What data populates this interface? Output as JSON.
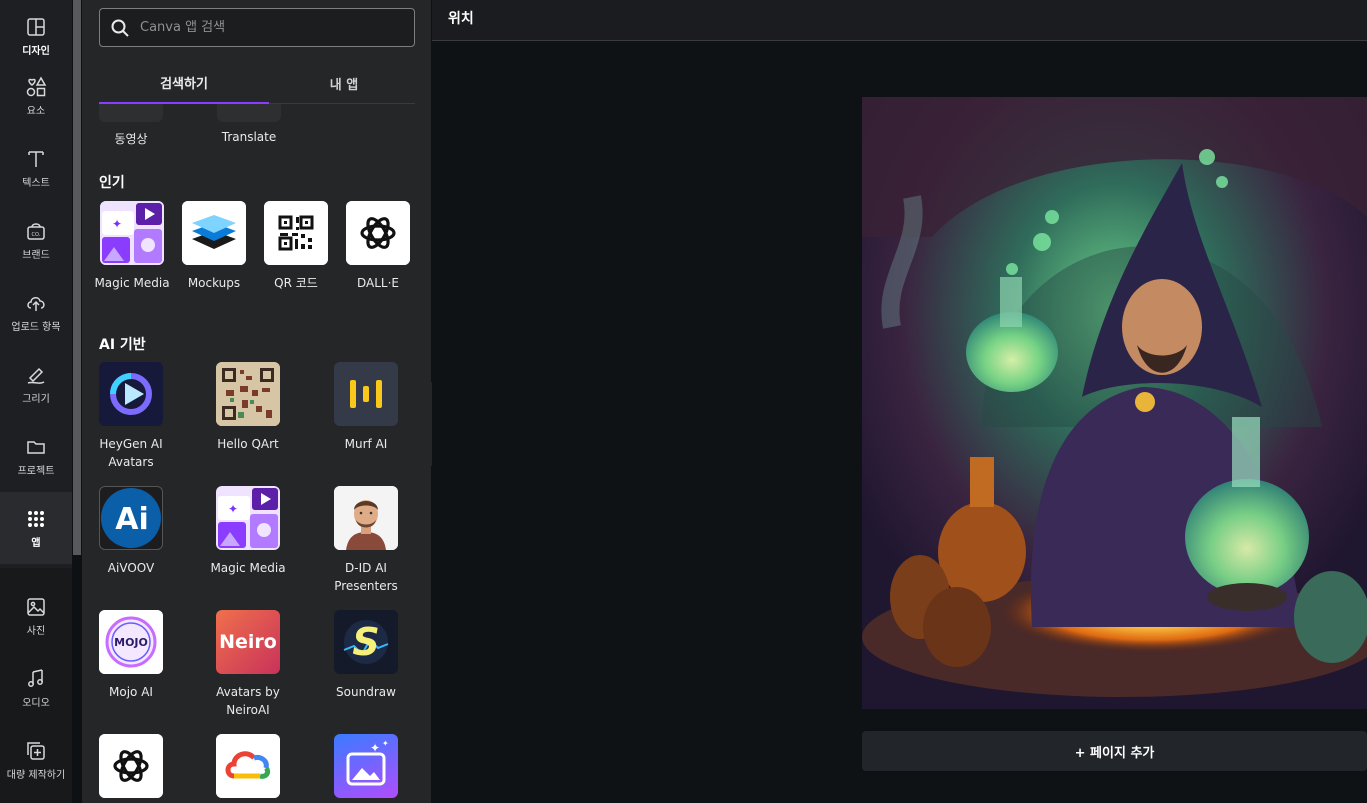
{
  "rail": {
    "items": [
      {
        "label": "디자인",
        "icon": "layout-icon"
      },
      {
        "label": "요소",
        "icon": "shapes-icon"
      },
      {
        "label": "텍스트",
        "icon": "text-icon"
      },
      {
        "label": "브랜드",
        "icon": "brand-icon"
      },
      {
        "label": "업로드 항목",
        "icon": "upload-icon"
      },
      {
        "label": "그리기",
        "icon": "draw-icon"
      },
      {
        "label": "프로젝트",
        "icon": "folder-icon"
      },
      {
        "label": "앱",
        "icon": "apps-grid-icon"
      },
      {
        "label": "사진",
        "icon": "photo-icon"
      },
      {
        "label": "오디오",
        "icon": "music-icon"
      },
      {
        "label": "대량 제작하기",
        "icon": "bulk-create-icon"
      }
    ],
    "active": "앱"
  },
  "panel": {
    "search_placeholder": "Canva 앱 검색",
    "tabs": [
      {
        "label": "검색하기",
        "active": true
      },
      {
        "label": "내 앱",
        "active": false
      }
    ],
    "previous_row": [
      {
        "label": "동영상"
      },
      {
        "label": "Translate"
      }
    ],
    "popular": {
      "title": "인기",
      "apps": [
        {
          "name": "Magic Media"
        },
        {
          "name": "Mockups"
        },
        {
          "name": "QR 코드"
        },
        {
          "name": "DALL·E"
        }
      ]
    },
    "ai": {
      "title": "AI 기반",
      "apps": [
        {
          "name": "HeyGen AI Avatars"
        },
        {
          "name": "Hello QArt"
        },
        {
          "name": "Murf AI"
        },
        {
          "name": "AiVOOV"
        },
        {
          "name": "Magic Media"
        },
        {
          "name": "D-ID AI Presenters"
        },
        {
          "name": "Mojo AI"
        },
        {
          "name": "Avatars by NeiroAI"
        },
        {
          "name": "Soundraw"
        },
        {
          "name": ""
        },
        {
          "name": ""
        },
        {
          "name": ""
        }
      ]
    },
    "logo_text": {
      "aivoov": "Ai",
      "mojo": "MOJO",
      "neiro": "Neiro",
      "soundraw": "S"
    }
  },
  "editor": {
    "title": "위치",
    "add_page": "+ 페이지 추가"
  },
  "colors": {
    "accent": "#8b3dff",
    "rail_bg": "#1e1f22",
    "panel_bg": "#252627",
    "canvas_bg": "#0f1215"
  }
}
